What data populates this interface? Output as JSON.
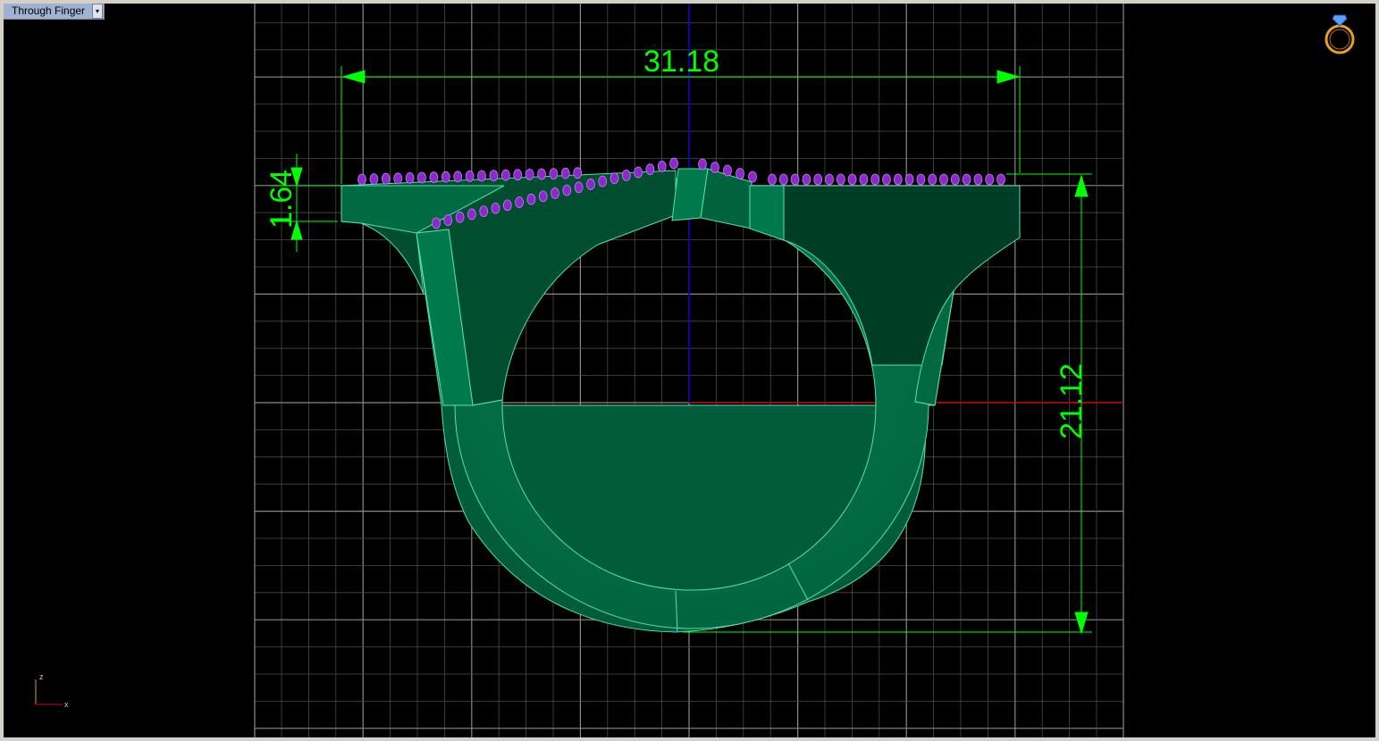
{
  "viewport": {
    "name": "Through Finger",
    "dropdown_glyph": "▾"
  },
  "dimensions": {
    "width_value": "31.18",
    "height_value": "21.12",
    "thickness_value": "1.64"
  },
  "axis_icon": {
    "z_label": "z",
    "x_label": "x"
  },
  "ring_icon": "ring-icon",
  "colors": {
    "background": "#000000",
    "grid": "#6e6e6e",
    "ring_body": "#00704a",
    "ring_dark": "#003d26",
    "ring_edge": "#52e3b0",
    "gem": "#8a2bc9",
    "dimension": "#00ff00",
    "x_axis": "#c00000",
    "z_axis": "#0000c8"
  }
}
